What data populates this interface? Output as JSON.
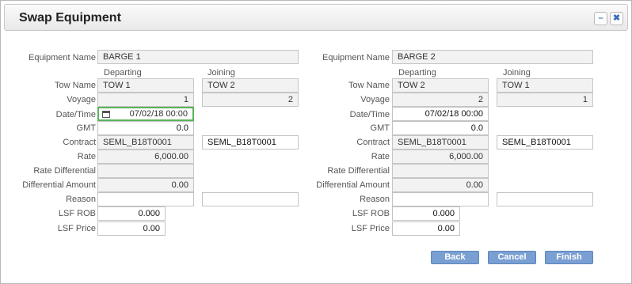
{
  "title": "Swap Equipment",
  "window_buttons": {
    "minimize": "–",
    "close": "✖"
  },
  "labels": {
    "equipment_name": "Equipment Name",
    "tow_name": "Tow Name",
    "voyage": "Voyage",
    "date_time": "Date/Time",
    "gmt": "GMT",
    "contract": "Contract",
    "rate": "Rate",
    "rate_differential": "Rate Differential",
    "differential_amount": "Differential Amount",
    "reason": "Reason",
    "lsf_rob": "LSF ROB",
    "lsf_price": "LSF Price"
  },
  "columns": {
    "departing": "Departing",
    "joining": "Joining"
  },
  "left": {
    "equipment_name": "BARGE 1",
    "departing": {
      "tow_name": "TOW 1",
      "voyage": "1",
      "date_time": "07/02/18 00:00",
      "gmt": "0.0",
      "contract": "SEML_B18T0001",
      "rate": "6,000.00",
      "rate_differential": "",
      "differential_amount": "0.00",
      "reason": "",
      "lsf_rob": "0.000",
      "lsf_price": "0.00"
    },
    "joining": {
      "tow_name": "TOW 2",
      "voyage": "2",
      "contract": "SEML_B18T0001",
      "reason": ""
    }
  },
  "right": {
    "equipment_name": "BARGE 2",
    "departing": {
      "tow_name": "TOW 2",
      "voyage": "2",
      "date_time": "07/02/18 00:00",
      "gmt": "0.0",
      "contract": "SEML_B18T0001",
      "rate": "6,000.00",
      "rate_differential": "",
      "differential_amount": "0.00",
      "reason": "",
      "lsf_rob": "0.000",
      "lsf_price": "0.00"
    },
    "joining": {
      "tow_name": "TOW 1",
      "voyage": "1",
      "contract": "SEML_B18T0001",
      "reason": ""
    }
  },
  "buttons": {
    "back": "Back",
    "cancel": "Cancel",
    "finish": "Finish"
  }
}
